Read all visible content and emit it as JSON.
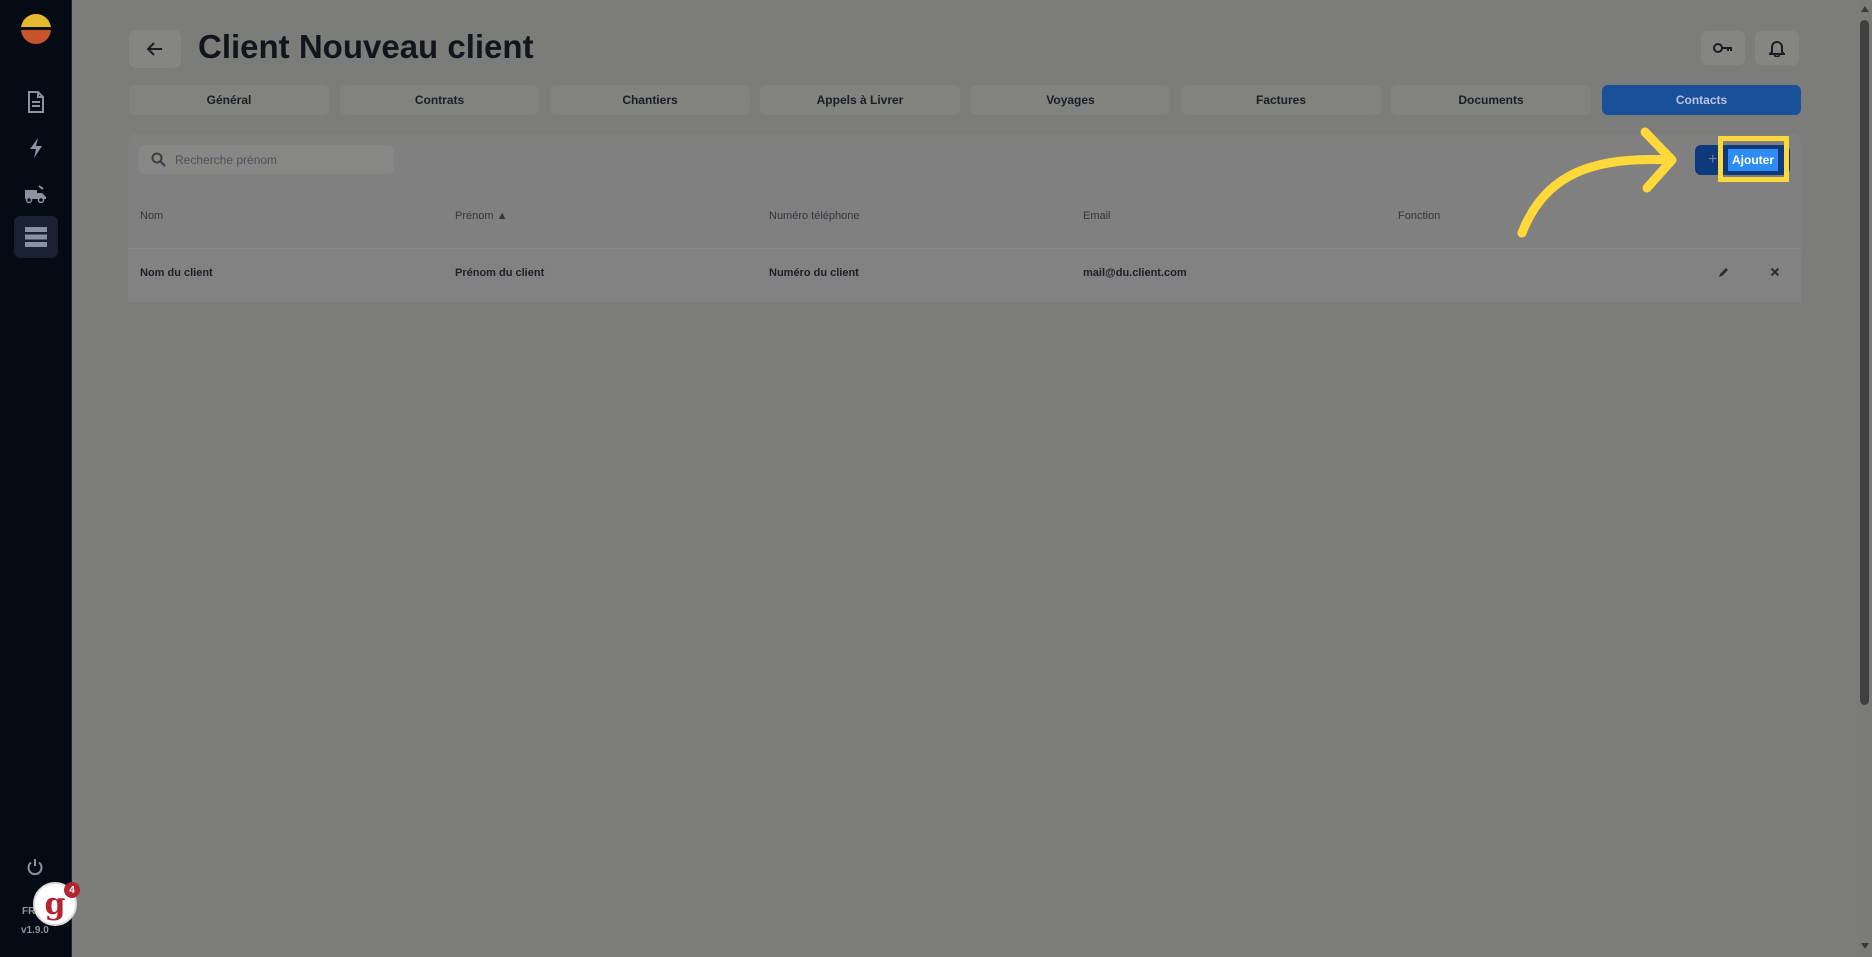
{
  "header": {
    "title": "Client Nouveau client"
  },
  "tabs": [
    {
      "label": "Général"
    },
    {
      "label": "Contrats"
    },
    {
      "label": "Chantiers"
    },
    {
      "label": "Appels à Livrer"
    },
    {
      "label": "Voyages"
    },
    {
      "label": "Factures"
    },
    {
      "label": "Documents"
    },
    {
      "label": "Contacts",
      "active": true
    }
  ],
  "search": {
    "placeholder": "Recherche prénom",
    "value": ""
  },
  "toolbar": {
    "add_label": "Ajouter",
    "add_icon": "plus-icon"
  },
  "table": {
    "columns": [
      "Nom",
      "Prénom ▲",
      "Numéro téléphone",
      "Email",
      "Fonction"
    ],
    "rows": [
      {
        "nom": "Nom du client",
        "prenom": "Prénom du client",
        "telephone": "Numéro du client",
        "email": "mail@du.client.com",
        "fonction": ""
      }
    ]
  },
  "sidebar": {
    "items": [
      {
        "icon": "document-icon"
      },
      {
        "icon": "lightning-icon"
      },
      {
        "icon": "truck-icon"
      },
      {
        "icon": "list-icon",
        "active": true
      }
    ],
    "bottom_text": "FR",
    "version": "v1.9.0"
  },
  "widget": {
    "letter": "g",
    "count": "4"
  },
  "colors": {
    "accent": "#1a4f9a",
    "highlight": "#ffd93a",
    "button": "#2f8cf3"
  }
}
